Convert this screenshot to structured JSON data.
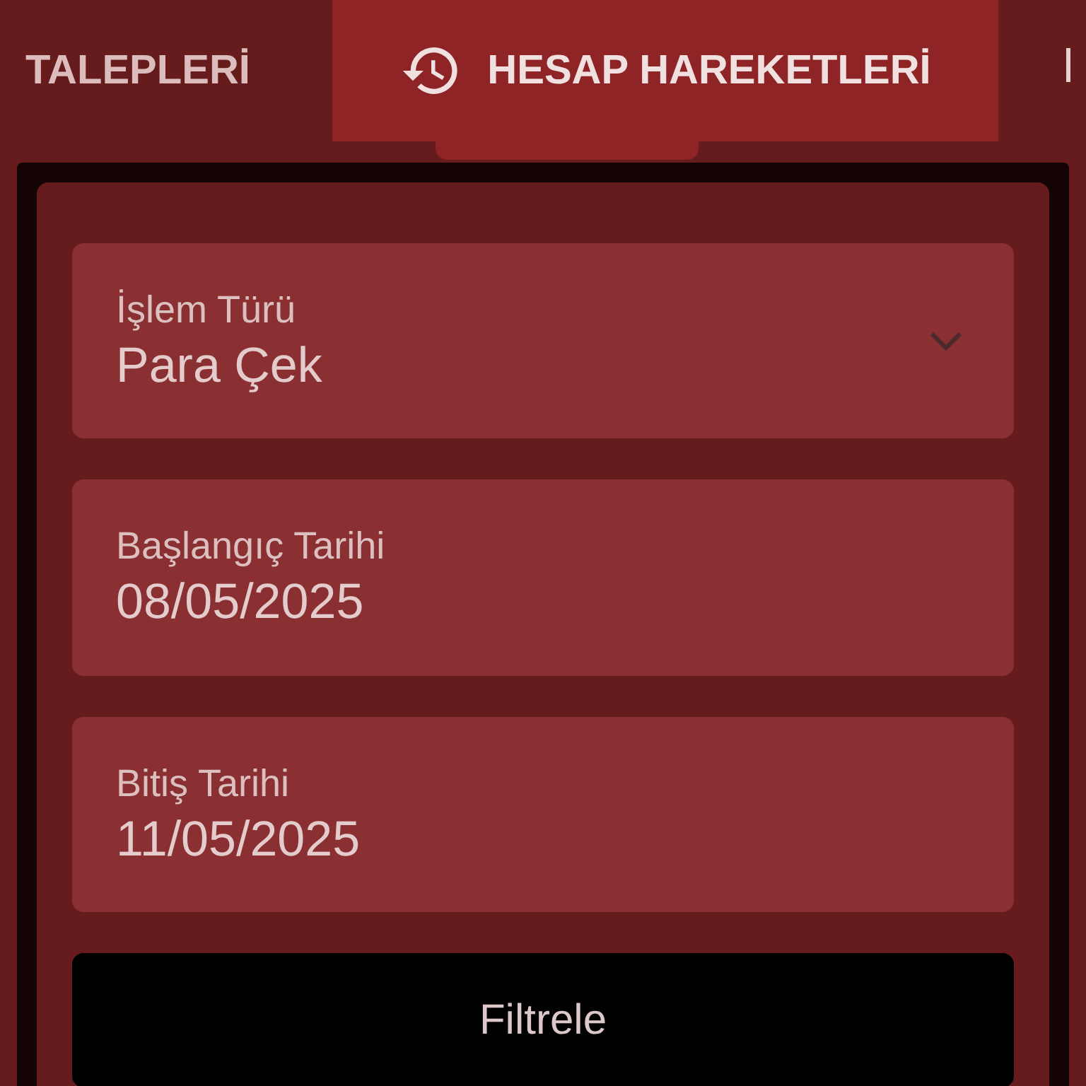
{
  "tabs": [
    {
      "label": "TALEPLERİ",
      "selected": false,
      "icon": false
    },
    {
      "label": "HESAP HAREKETLERİ",
      "selected": true,
      "icon": true
    }
  ],
  "fields": [
    {
      "kind": "select",
      "label": "İşlem Türü",
      "value": "Para Çek"
    },
    {
      "kind": "date",
      "label": "Başlangıç Tarihi",
      "value": "08/05/2025"
    },
    {
      "kind": "date",
      "label": "Bitiş Tarihi",
      "value": "11/05/2025"
    }
  ],
  "button": "Filtrele"
}
